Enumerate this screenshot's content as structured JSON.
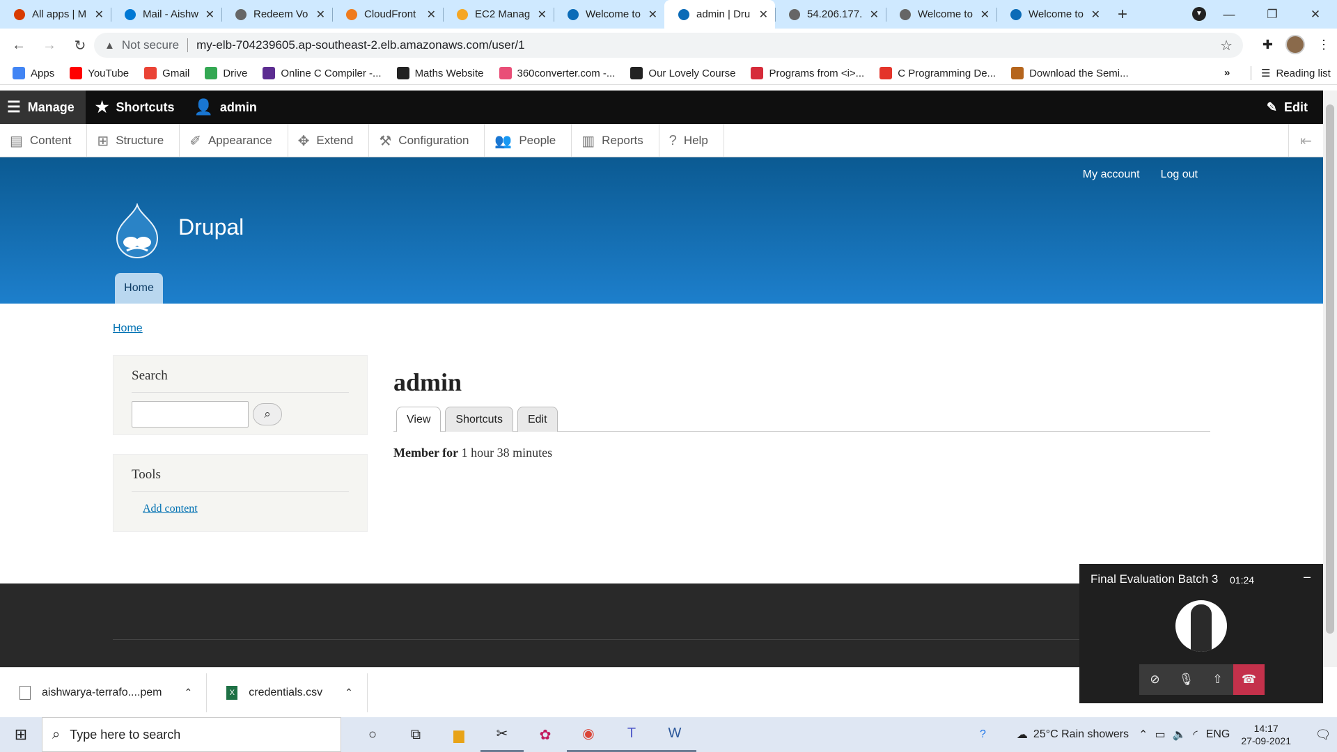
{
  "browser": {
    "tabs": [
      {
        "title": "All apps | M",
        "color": "#d83b01"
      },
      {
        "title": "Mail - Aishw",
        "color": "#0078d4"
      },
      {
        "title": "Redeem Vo",
        "color": "#666666"
      },
      {
        "title": "CloudFront",
        "color": "#ef7b1e"
      },
      {
        "title": "EC2 Manag",
        "color": "#f5a623"
      },
      {
        "title": "Welcome to",
        "color": "#0b6bb7"
      },
      {
        "title": "admin | Dru",
        "color": "#0b6bb7"
      },
      {
        "title": "54.206.177.",
        "color": "#666666"
      },
      {
        "title": "Welcome to",
        "color": "#666666"
      },
      {
        "title": "Welcome to",
        "color": "#0b6bb7"
      }
    ],
    "active_tab": 6,
    "close_glyph": "✕",
    "new_tab": "+",
    "address": {
      "security": "Not secure",
      "url": "my-elb-704239605.ap-southeast-2.elb.amazonaws.com/user/1"
    },
    "bookmarks": [
      {
        "label": "Apps",
        "color": "#4285f4"
      },
      {
        "label": "YouTube",
        "color": "#ff0000"
      },
      {
        "label": "Gmail",
        "color": "#ea4335"
      },
      {
        "label": "Drive",
        "color": "#34a853"
      },
      {
        "label": "Online C Compiler -...",
        "color": "#5c2d91"
      },
      {
        "label": "Maths Website",
        "color": "#222222"
      },
      {
        "label": "360converter.com -...",
        "color": "#e94e77"
      },
      {
        "label": "Our Lovely Course",
        "color": "#222222"
      },
      {
        "label": "Programs from <i>...",
        "color": "#d62b3a"
      },
      {
        "label": "C Programming De...",
        "color": "#e4342a"
      },
      {
        "label": "Download the Semi...",
        "color": "#b5651d"
      }
    ],
    "bookmarks_more": "»",
    "reading_list": "Reading list"
  },
  "toolbar": {
    "manage": "Manage",
    "shortcuts": "Shortcuts",
    "user": "admin",
    "edit": "Edit"
  },
  "menu": [
    "Content",
    "Structure",
    "Appearance",
    "Extend",
    "Configuration",
    "People",
    "Reports",
    "Help"
  ],
  "header": {
    "my_account": "My account",
    "log_out": "Log out",
    "site_name": "Drupal",
    "home_tab": "Home"
  },
  "breadcrumb": "Home",
  "sidebar": {
    "search_title": "Search",
    "tools_title": "Tools",
    "add_content": "Add content"
  },
  "main": {
    "title": "admin",
    "tabs": [
      "View",
      "Shortcuts",
      "Edit"
    ],
    "member_label": "Member for",
    "member_value": "1 hour 38 minutes"
  },
  "call": {
    "title": "Final Evaluation Batch 3",
    "time": "01:24"
  },
  "downloads": [
    {
      "name": "aishwarya-terrafo....pem"
    },
    {
      "name": "credentials.csv"
    }
  ],
  "taskbar": {
    "search_placeholder": "Type here to search",
    "weather": "25°C  Rain showers",
    "lang": "ENG",
    "time": "14:17",
    "date": "27-09-2021"
  }
}
